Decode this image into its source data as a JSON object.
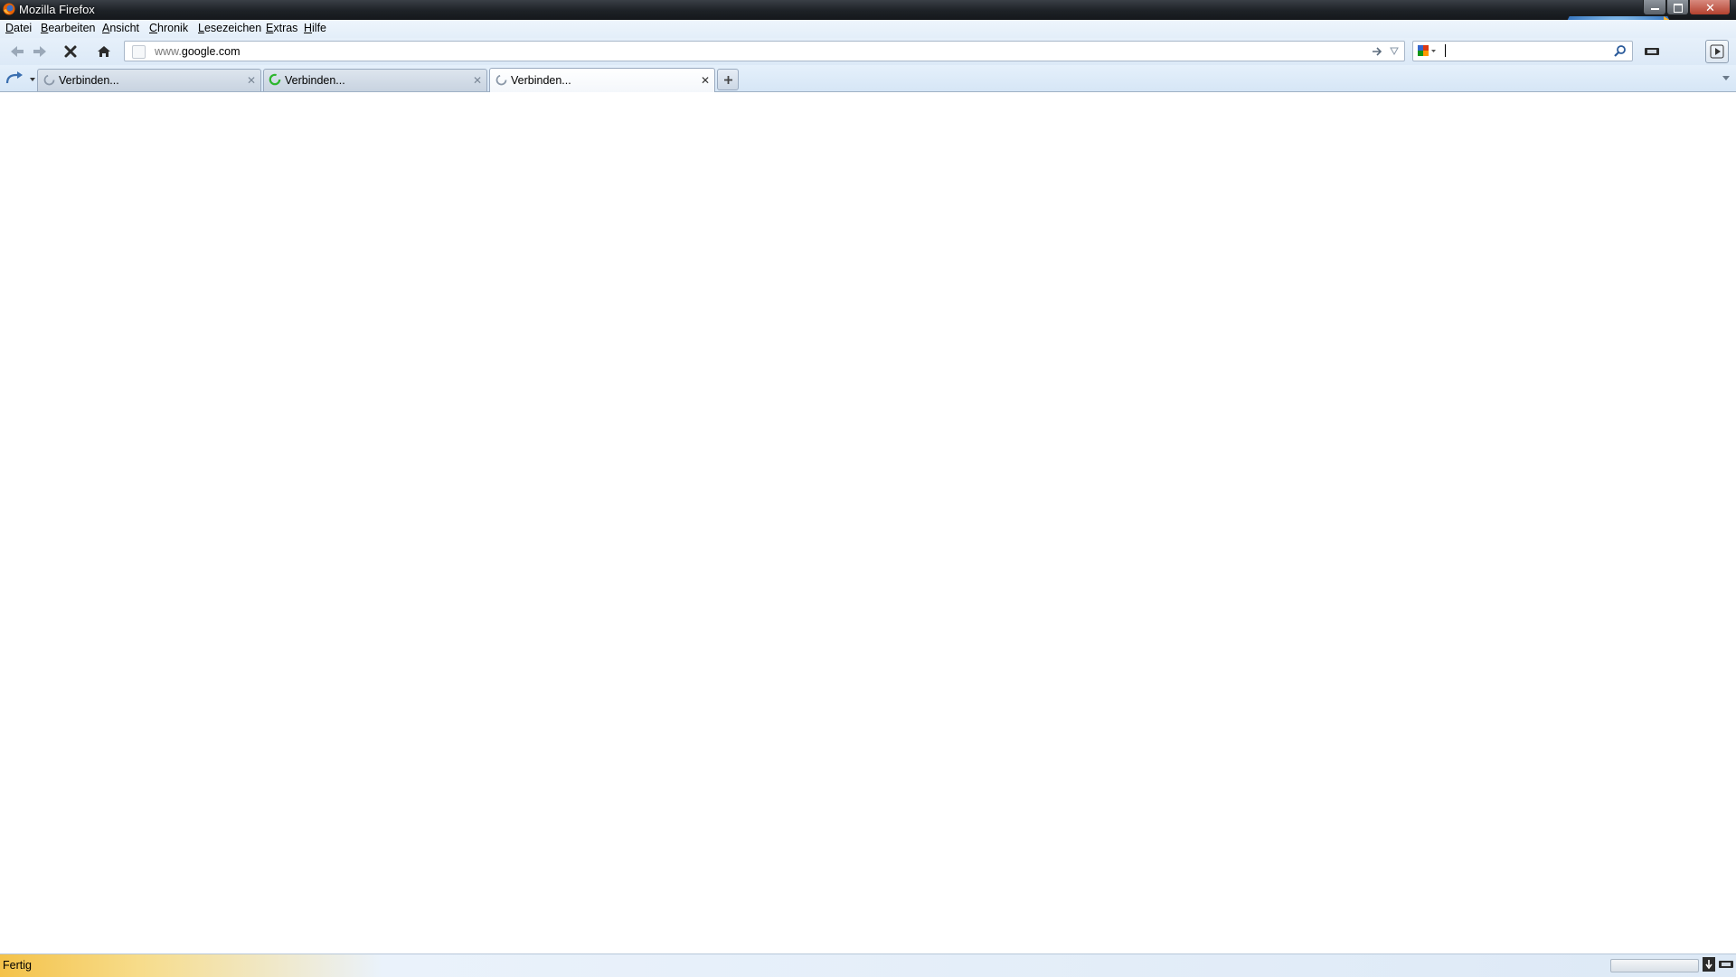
{
  "window": {
    "title": "Mozilla Firefox"
  },
  "menubar": {
    "items": [
      "Datei",
      "Bearbeiten",
      "Ansicht",
      "Chronik",
      "Lesezeichen",
      "Extras",
      "Hilfe"
    ]
  },
  "navbar": {
    "url_prefix": "www.",
    "url_host": "google.com",
    "search_value": ""
  },
  "tabs": [
    {
      "label": "Verbinden...",
      "state": "loading",
      "active": false
    },
    {
      "label": "Verbinden...",
      "state": "loading-green",
      "active": false
    },
    {
      "label": "Verbinden...",
      "state": "loading",
      "active": true
    }
  ],
  "status": {
    "text": "Fertig"
  },
  "icons": {
    "back": "back-arrow-icon",
    "forward": "forward-arrow-icon",
    "stop": "stop-icon",
    "home": "home-icon",
    "go": "go-arrow-icon",
    "search": "magnifier-icon",
    "new_tab": "plus-icon"
  },
  "colors": {
    "chrome_blue": "#dce9f7",
    "status_yellow": "#f4c24a",
    "firefox_orange": "#e66000"
  }
}
